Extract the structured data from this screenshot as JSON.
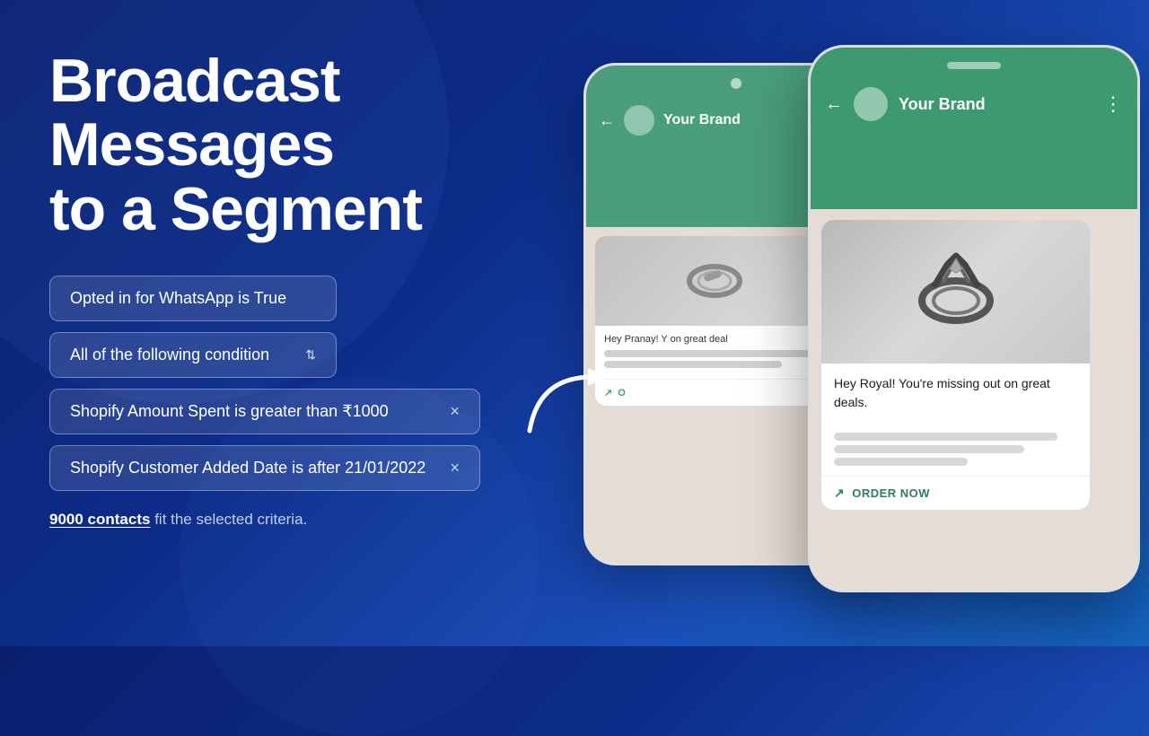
{
  "page": {
    "background": "#0a1f6e"
  },
  "left": {
    "headline_line1": "Broadcast",
    "headline_line2": "Messages",
    "headline_line3": "to a Segment",
    "condition1": {
      "label": "Opted in for WhatsApp is True"
    },
    "condition2": {
      "label": "All of the following condition",
      "type": "select"
    },
    "condition3": {
      "label": "Shopify Amount Spent is greater than ₹1000",
      "has_close": true
    },
    "condition4": {
      "label": "Shopify Customer Added Date is after 21/01/2022",
      "has_close": true
    },
    "contacts_count": "9000 contacts",
    "contacts_suffix": " fit the selected criteria.",
    "close_symbol": "×",
    "arrow_up_down": "⇕"
  },
  "phone_back": {
    "brand": "Your Brand",
    "chat_preview": "Hey Pranay! Y on great deal",
    "order_now": "O"
  },
  "phone_front": {
    "brand": "Your Brand",
    "chat_text": "Hey Royal! You're missing out on great deals.",
    "order_now": "ORDER NOW"
  }
}
